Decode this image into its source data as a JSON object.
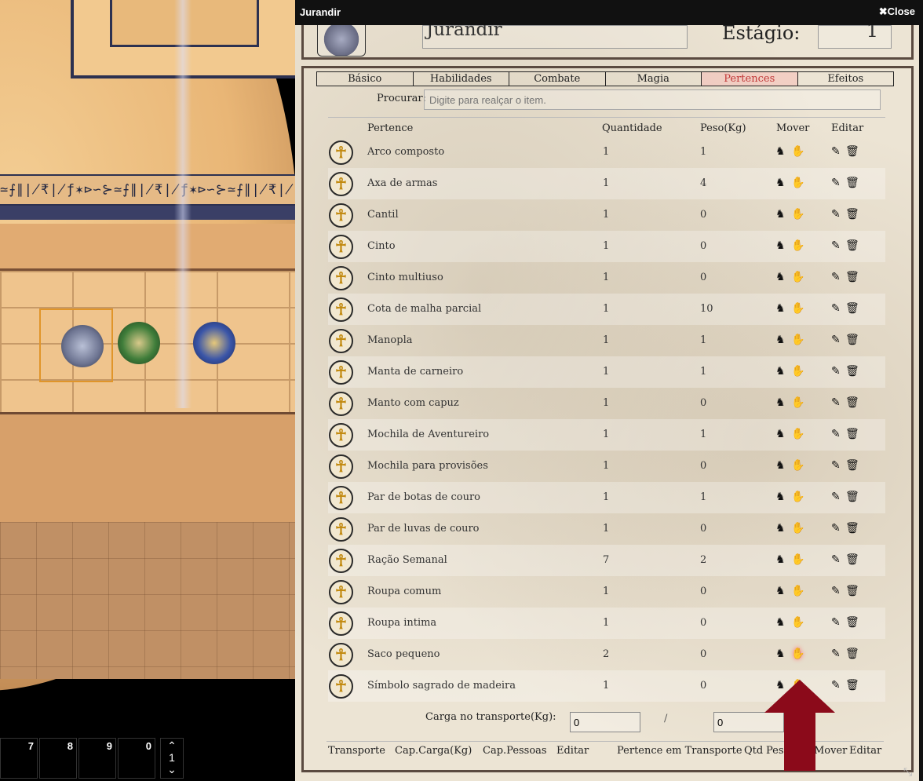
{
  "hotbar": {
    "slots": [
      "7",
      "8",
      "9",
      "0"
    ],
    "page": "1",
    "up": "⌃",
    "down": "⌄"
  },
  "map": {
    "glyphs": "≃⨍∥∤₹∤ƒ✶⊳∽⊱≃⨍∥∤₹∤ƒ✶⊳∽⊱≃⨍∥∤₹∤ƒ✶⊳"
  },
  "dialog": {
    "title": "Jurandir",
    "close_label": "✖Close",
    "name": "Jurandir",
    "stage_label": "Estágio:",
    "stage_value": "1",
    "tabs": [
      {
        "label": "Básico"
      },
      {
        "label": "Habilidades"
      },
      {
        "label": "Combate"
      },
      {
        "label": "Magia"
      },
      {
        "label": "Pertences"
      },
      {
        "label": "Efeitos"
      }
    ],
    "active_tab": "Pertences",
    "search_label": "Procurar:",
    "search_placeholder": "Digite para realçar o item.",
    "columns": {
      "item": "Pertence",
      "qty": "Quantidade",
      "weight": "Peso(Kg)",
      "move": "Mover",
      "edit": "Editar"
    },
    "items": [
      {
        "name": "Arco composto",
        "qty": "1",
        "weight": "1"
      },
      {
        "name": "Axa de armas",
        "qty": "1",
        "weight": "4"
      },
      {
        "name": "Cantil",
        "qty": "1",
        "weight": "0"
      },
      {
        "name": "Cinto",
        "qty": "1",
        "weight": "0"
      },
      {
        "name": "Cinto multiuso",
        "qty": "1",
        "weight": "0"
      },
      {
        "name": "Cota de malha parcial",
        "qty": "1",
        "weight": "10"
      },
      {
        "name": "Manopla",
        "qty": "1",
        "weight": "1"
      },
      {
        "name": "Manta de carneiro",
        "qty": "1",
        "weight": "1"
      },
      {
        "name": "Manto com capuz",
        "qty": "1",
        "weight": "0"
      },
      {
        "name": "Mochila de Aventureiro",
        "qty": "1",
        "weight": "1"
      },
      {
        "name": "Mochila para provisões",
        "qty": "1",
        "weight": "0"
      },
      {
        "name": "Par de botas de couro",
        "qty": "1",
        "weight": "1"
      },
      {
        "name": "Par de luvas de couro",
        "qty": "1",
        "weight": "0"
      },
      {
        "name": "Ração Semanal",
        "qty": "7",
        "weight": "2"
      },
      {
        "name": "Roupa comum",
        "qty": "1",
        "weight": "0"
      },
      {
        "name": "Roupa intima",
        "qty": "1",
        "weight": "0"
      },
      {
        "name": "Saco pequeno",
        "qty": "2",
        "weight": "0"
      },
      {
        "name": "Símbolo sagrado de madeira",
        "qty": "1",
        "weight": "0"
      }
    ],
    "icons": {
      "item": "ankh-icon",
      "move_mount": "horse-icon",
      "move_give": "handshake-icon",
      "edit": "edit-icon",
      "delete": "trash-icon"
    },
    "highlighted_row": "Saco pequeno",
    "cargo_label": "Carga no transporte(Kg):",
    "cargo_value1": "0",
    "cargo_sep": "/",
    "cargo_value2": "0",
    "transport_columns": [
      "Transporte",
      "Cap.Carga(Kg)",
      "Cap.Pessoas",
      "Editar",
      "Pertence em Transporte",
      "Qtd",
      "Peso(Kg)",
      "Mover",
      "Editar"
    ]
  },
  "colors": {
    "active_tab": "#c23a3a",
    "arrow": "#8b0a1a",
    "title_bar": "#111111"
  }
}
